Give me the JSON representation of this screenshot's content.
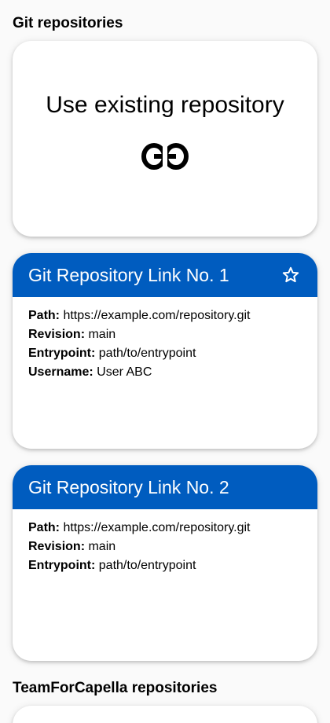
{
  "sections": {
    "git_title": "Git repositories",
    "t4c_title": "TeamForCapella repositories"
  },
  "existing": {
    "title": "Use existing repository",
    "icon": "link-icon"
  },
  "repos": [
    {
      "title": "Git Repository Link No. 1",
      "starred_icon": "star-outline-icon",
      "rows": [
        {
          "label": "Path:",
          "value": "https://example.com/repository.git"
        },
        {
          "label": "Revision:",
          "value": "main"
        },
        {
          "label": "Entrypoint:",
          "value": "path/to/entrypoint"
        },
        {
          "label": "Username:",
          "value": "User ABC"
        }
      ]
    },
    {
      "title": "Git Repository Link No. 2",
      "rows": [
        {
          "label": "Path:",
          "value": "https://example.com/repository.git"
        },
        {
          "label": "Revision:",
          "value": "main"
        },
        {
          "label": "Entrypoint:",
          "value": "path/to/entrypoint"
        }
      ]
    }
  ],
  "colors": {
    "header": "#005cbf",
    "background": "#fafafa",
    "card": "#ffffff"
  }
}
